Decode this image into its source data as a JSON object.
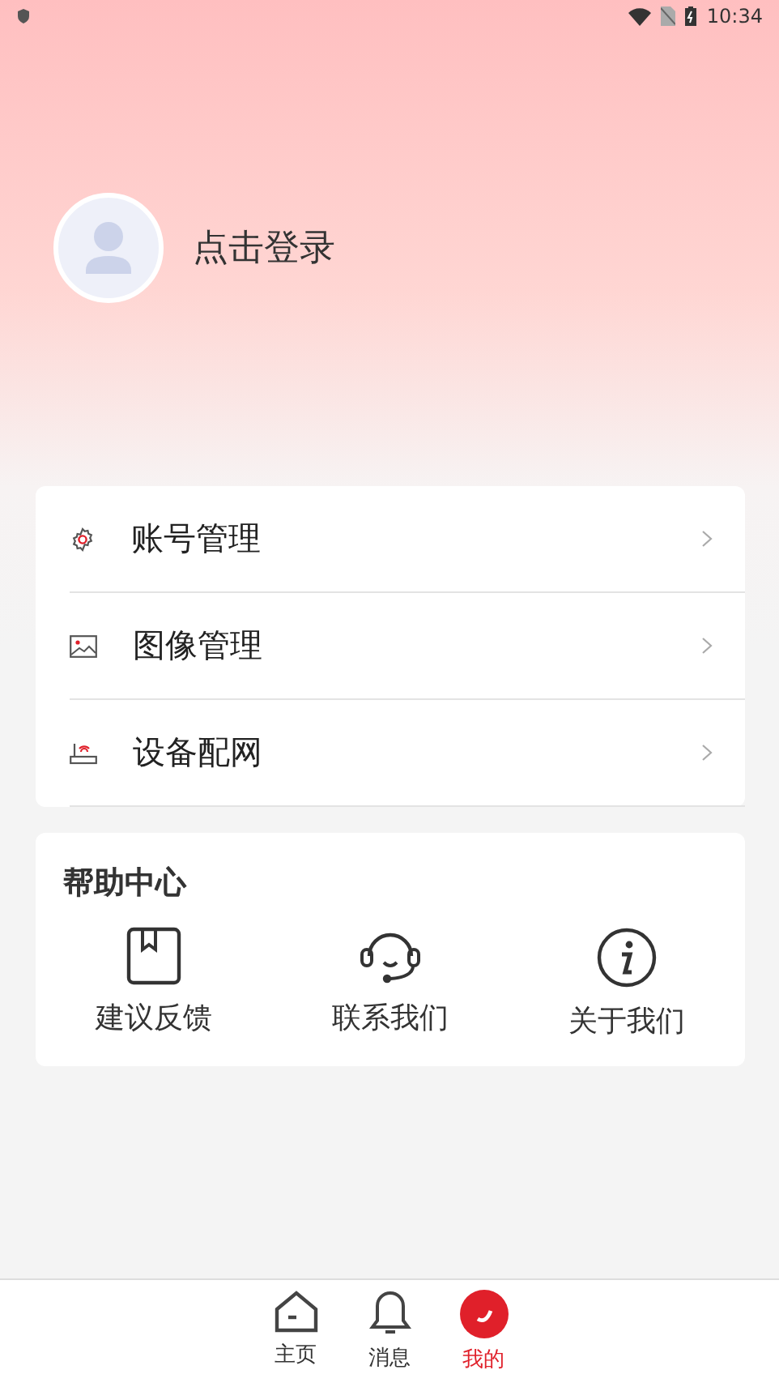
{
  "status_bar": {
    "time": "10:34"
  },
  "profile": {
    "login_label": "点击登录"
  },
  "menu": [
    {
      "kind": "account",
      "label": "账号管理"
    },
    {
      "kind": "image",
      "label": "图像管理"
    },
    {
      "kind": "network",
      "label": "设备配网"
    }
  ],
  "help_center": {
    "title": "帮助中心",
    "items": [
      {
        "kind": "feedback",
        "label": "建议反馈"
      },
      {
        "kind": "contact",
        "label": "联系我们"
      },
      {
        "kind": "about",
        "label": "关于我们"
      }
    ]
  },
  "tabs": [
    {
      "kind": "home",
      "label": "主页",
      "selected": false
    },
    {
      "kind": "messages",
      "label": "消息",
      "selected": false
    },
    {
      "kind": "mine",
      "label": "我的",
      "selected": true
    }
  ]
}
